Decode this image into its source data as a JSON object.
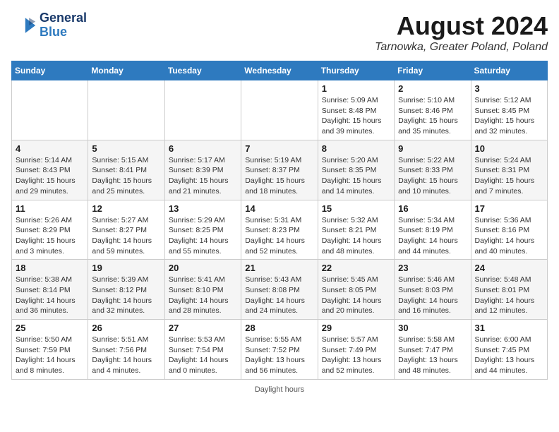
{
  "header": {
    "logo_line1": "General",
    "logo_line2": "Blue",
    "month_year": "August 2024",
    "location": "Tarnowka, Greater Poland, Poland"
  },
  "days_of_week": [
    "Sunday",
    "Monday",
    "Tuesday",
    "Wednesday",
    "Thursday",
    "Friday",
    "Saturday"
  ],
  "weeks": [
    [
      {
        "day": "",
        "info": ""
      },
      {
        "day": "",
        "info": ""
      },
      {
        "day": "",
        "info": ""
      },
      {
        "day": "",
        "info": ""
      },
      {
        "day": "1",
        "info": "Sunrise: 5:09 AM\nSunset: 8:48 PM\nDaylight: 15 hours\nand 39 minutes."
      },
      {
        "day": "2",
        "info": "Sunrise: 5:10 AM\nSunset: 8:46 PM\nDaylight: 15 hours\nand 35 minutes."
      },
      {
        "day": "3",
        "info": "Sunrise: 5:12 AM\nSunset: 8:45 PM\nDaylight: 15 hours\nand 32 minutes."
      }
    ],
    [
      {
        "day": "4",
        "info": "Sunrise: 5:14 AM\nSunset: 8:43 PM\nDaylight: 15 hours\nand 29 minutes."
      },
      {
        "day": "5",
        "info": "Sunrise: 5:15 AM\nSunset: 8:41 PM\nDaylight: 15 hours\nand 25 minutes."
      },
      {
        "day": "6",
        "info": "Sunrise: 5:17 AM\nSunset: 8:39 PM\nDaylight: 15 hours\nand 21 minutes."
      },
      {
        "day": "7",
        "info": "Sunrise: 5:19 AM\nSunset: 8:37 PM\nDaylight: 15 hours\nand 18 minutes."
      },
      {
        "day": "8",
        "info": "Sunrise: 5:20 AM\nSunset: 8:35 PM\nDaylight: 15 hours\nand 14 minutes."
      },
      {
        "day": "9",
        "info": "Sunrise: 5:22 AM\nSunset: 8:33 PM\nDaylight: 15 hours\nand 10 minutes."
      },
      {
        "day": "10",
        "info": "Sunrise: 5:24 AM\nSunset: 8:31 PM\nDaylight: 15 hours\nand 7 minutes."
      }
    ],
    [
      {
        "day": "11",
        "info": "Sunrise: 5:26 AM\nSunset: 8:29 PM\nDaylight: 15 hours\nand 3 minutes."
      },
      {
        "day": "12",
        "info": "Sunrise: 5:27 AM\nSunset: 8:27 PM\nDaylight: 14 hours\nand 59 minutes."
      },
      {
        "day": "13",
        "info": "Sunrise: 5:29 AM\nSunset: 8:25 PM\nDaylight: 14 hours\nand 55 minutes."
      },
      {
        "day": "14",
        "info": "Sunrise: 5:31 AM\nSunset: 8:23 PM\nDaylight: 14 hours\nand 52 minutes."
      },
      {
        "day": "15",
        "info": "Sunrise: 5:32 AM\nSunset: 8:21 PM\nDaylight: 14 hours\nand 48 minutes."
      },
      {
        "day": "16",
        "info": "Sunrise: 5:34 AM\nSunset: 8:19 PM\nDaylight: 14 hours\nand 44 minutes."
      },
      {
        "day": "17",
        "info": "Sunrise: 5:36 AM\nSunset: 8:16 PM\nDaylight: 14 hours\nand 40 minutes."
      }
    ],
    [
      {
        "day": "18",
        "info": "Sunrise: 5:38 AM\nSunset: 8:14 PM\nDaylight: 14 hours\nand 36 minutes."
      },
      {
        "day": "19",
        "info": "Sunrise: 5:39 AM\nSunset: 8:12 PM\nDaylight: 14 hours\nand 32 minutes."
      },
      {
        "day": "20",
        "info": "Sunrise: 5:41 AM\nSunset: 8:10 PM\nDaylight: 14 hours\nand 28 minutes."
      },
      {
        "day": "21",
        "info": "Sunrise: 5:43 AM\nSunset: 8:08 PM\nDaylight: 14 hours\nand 24 minutes."
      },
      {
        "day": "22",
        "info": "Sunrise: 5:45 AM\nSunset: 8:05 PM\nDaylight: 14 hours\nand 20 minutes."
      },
      {
        "day": "23",
        "info": "Sunrise: 5:46 AM\nSunset: 8:03 PM\nDaylight: 14 hours\nand 16 minutes."
      },
      {
        "day": "24",
        "info": "Sunrise: 5:48 AM\nSunset: 8:01 PM\nDaylight: 14 hours\nand 12 minutes."
      }
    ],
    [
      {
        "day": "25",
        "info": "Sunrise: 5:50 AM\nSunset: 7:59 PM\nDaylight: 14 hours\nand 8 minutes."
      },
      {
        "day": "26",
        "info": "Sunrise: 5:51 AM\nSunset: 7:56 PM\nDaylight: 14 hours\nand 4 minutes."
      },
      {
        "day": "27",
        "info": "Sunrise: 5:53 AM\nSunset: 7:54 PM\nDaylight: 14 hours\nand 0 minutes."
      },
      {
        "day": "28",
        "info": "Sunrise: 5:55 AM\nSunset: 7:52 PM\nDaylight: 13 hours\nand 56 minutes."
      },
      {
        "day": "29",
        "info": "Sunrise: 5:57 AM\nSunset: 7:49 PM\nDaylight: 13 hours\nand 52 minutes."
      },
      {
        "day": "30",
        "info": "Sunrise: 5:58 AM\nSunset: 7:47 PM\nDaylight: 13 hours\nand 48 minutes."
      },
      {
        "day": "31",
        "info": "Sunrise: 6:00 AM\nSunset: 7:45 PM\nDaylight: 13 hours\nand 44 minutes."
      }
    ]
  ],
  "footer": {
    "note": "Daylight hours"
  }
}
